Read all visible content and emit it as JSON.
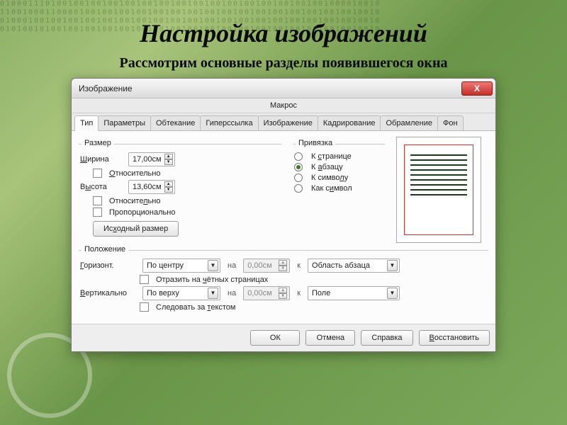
{
  "slide": {
    "title": "Настройка изображений",
    "subtitle": "Рассмотрим основные разделы появившегося окна"
  },
  "dialog": {
    "title": "Изображение",
    "close": "X",
    "macro": "Макрос",
    "tabs": [
      "Тип",
      "Параметры",
      "Обтекание",
      "Гиперссылка",
      "Изображение",
      "Кадрирование",
      "Обрамление",
      "Фон"
    ],
    "active_tab": 0,
    "size": {
      "legend": "Размер",
      "width_label_pre": "Ш",
      "width_label_post": "ирина",
      "width_value": "17,00см",
      "rel_width": "тносительно",
      "rel_width_u": "О",
      "height_label_pre": "В",
      "height_label_u": "ы",
      "height_label_post": "сота",
      "height_value": "13,60см",
      "rel_height_pre": "Относите",
      "rel_height_u": "л",
      "rel_height_post": "ьно",
      "proportional": "Пропорционально",
      "orig_pre": "Ис",
      "orig_u": "х",
      "orig_post": "одный размер"
    },
    "anchor": {
      "legend": "Привязка",
      "r1_pre": "К ",
      "r1_u": "с",
      "r1_post": "транице",
      "r2_pre": "К ",
      "r2_u": "а",
      "r2_post": "бзацу",
      "r3_pre": "К симво",
      "r3_u": "л",
      "r3_post": "у",
      "r4_pre": "Как с",
      "r4_u": "и",
      "r4_post": "мвол",
      "selected": 1
    },
    "position": {
      "legend": "Положение",
      "horiz_u": "Г",
      "horiz_post": "оризонт.",
      "horiz_value": "По центру",
      "na": "на",
      "offset": "0,00см",
      "k": "к",
      "horiz_ref": "Область абзаца",
      "mirror_pre": "Отразить на ",
      "mirror_u": "ч",
      "mirror_post": "ётных страницах",
      "vert_u": "В",
      "vert_post": "ертикально",
      "vert_value": "По верху",
      "vert_ref": "Поле",
      "follow_pre": "Следовать за ",
      "follow_u": "т",
      "follow_post": "екстом"
    },
    "buttons": {
      "ok": "ОК",
      "cancel": "Отмена",
      "help": "Справка",
      "reset_u": "В",
      "reset_post": "осстановить"
    }
  }
}
